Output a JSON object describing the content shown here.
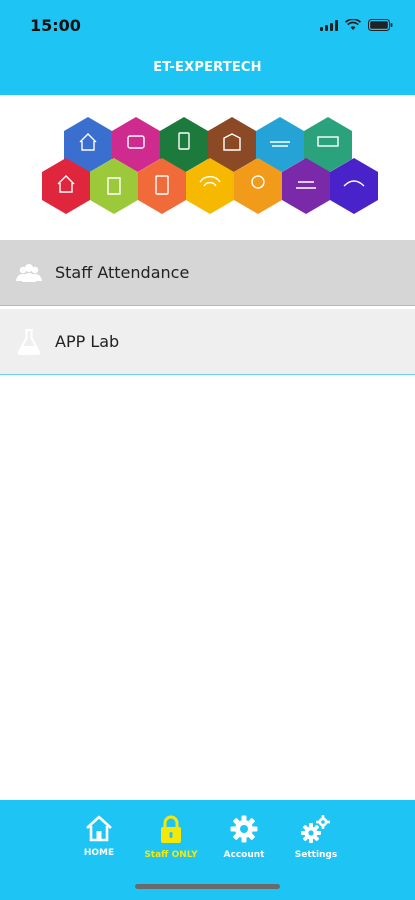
{
  "status_bar": {
    "time": "15:00"
  },
  "header": {
    "title": "ET-EXPERTECH"
  },
  "banner": {
    "image": "colorful-hexagon-services-banner"
  },
  "menu": {
    "items": [
      {
        "label": "Staff Attendance",
        "icon": "staff-group-icon"
      },
      {
        "label": "APP Lab",
        "icon": "flask-icon"
      }
    ]
  },
  "tabbar": {
    "tabs": [
      {
        "label": "HOME",
        "icon": "home-icon"
      },
      {
        "label": "Staff ONLY",
        "icon": "lock-icon",
        "active": true
      },
      {
        "label": "Account",
        "icon": "gear-icon"
      },
      {
        "label": "Settings",
        "icon": "gears-icon"
      }
    ]
  },
  "colors": {
    "accent": "#1ec4f4",
    "active_tab": "#f4e80a",
    "selected_row": "#d6d6d6"
  }
}
